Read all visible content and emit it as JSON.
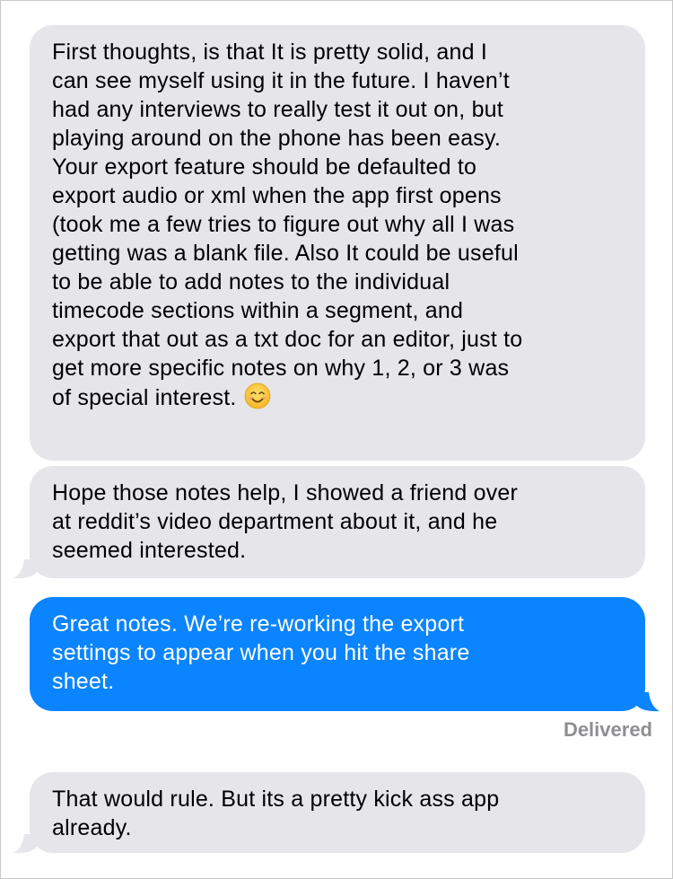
{
  "messages": [
    {
      "direction": "incoming",
      "lines": [
        "First thoughts, is that It is pretty solid, and I",
        "can see myself using it in the future. I haven’t",
        "had any interviews to really test it out on, but",
        "playing around on the phone has been easy.",
        "Your export feature should be defaulted to",
        "export audio or xml when the app first opens",
        "(took me a few tries to figure out why all I was",
        "getting was a blank file. Also It could be useful",
        "to be able to add notes to the individual",
        "timecode sections within a segment, and",
        "export that out as a txt doc for an editor, just to",
        "get more specific notes on why 1, 2, or 3 was",
        "of special interest."
      ],
      "emoji": "smiling-face-emoji"
    },
    {
      "direction": "incoming",
      "lines": [
        "Hope those notes help, I showed a friend over",
        "at reddit’s video department about it, and he",
        "seemed interested."
      ]
    },
    {
      "direction": "outgoing",
      "lines": [
        "Great notes. We’re re-working the export",
        "settings to appear when you hit the share",
        "sheet."
      ]
    },
    {
      "direction": "incoming",
      "lines": [
        "That would rule. But its a pretty kick ass app",
        "already."
      ]
    }
  ],
  "status": {
    "delivered_label": "Delivered"
  },
  "colors": {
    "incoming_bubble": "#e5e5ea",
    "outgoing_bubble": "#0a84ff",
    "status_text": "#8e8e93"
  }
}
